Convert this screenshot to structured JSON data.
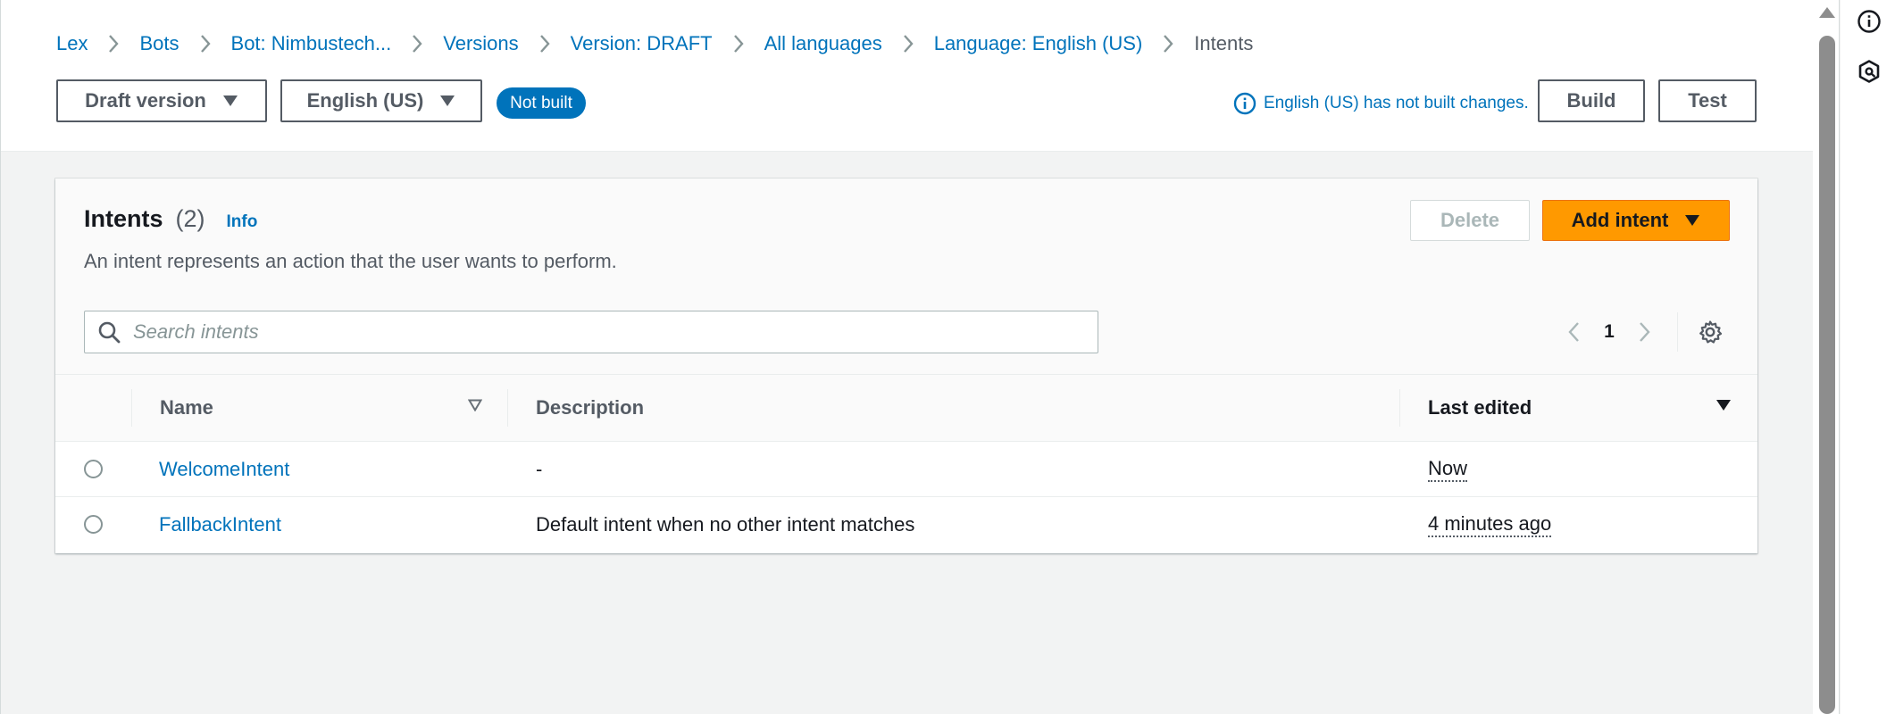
{
  "breadcrumb": [
    {
      "label": "Lex"
    },
    {
      "label": "Bots"
    },
    {
      "label": "Bot: Nimbustech..."
    },
    {
      "label": "Versions"
    },
    {
      "label": "Version: DRAFT"
    },
    {
      "label": "All languages"
    },
    {
      "label": "Language: English (US)"
    },
    {
      "label": "Intents"
    }
  ],
  "toolbar": {
    "version_label": "Draft version",
    "language_label": "English (US)",
    "status_badge": "Not built",
    "status_message": "English (US) has not built changes.",
    "build_label": "Build",
    "test_label": "Test"
  },
  "panel": {
    "title": "Intents",
    "count": "(2)",
    "info_label": "Info",
    "description": "An intent represents an action that the user wants to perform.",
    "delete_label": "Delete",
    "add_label": "Add intent"
  },
  "search": {
    "placeholder": "Search intents",
    "value": ""
  },
  "pagination": {
    "current_page": "1"
  },
  "table": {
    "headers": {
      "name": "Name",
      "description": "Description",
      "last_edited": "Last edited"
    },
    "rows": [
      {
        "name": "WelcomeIntent",
        "description": "-",
        "last_edited": "Now"
      },
      {
        "name": "FallbackIntent",
        "description": "Default intent when no other intent matches",
        "last_edited": "4 minutes ago"
      }
    ]
  },
  "colors": {
    "link": "#0073bb",
    "primary_button": "#ff9900",
    "badge": "#0073bb",
    "text": "#16191f",
    "muted_text": "#545b64"
  },
  "icons": {
    "breadcrumb_separator": "chevron-right-icon",
    "dropdown": "caret-down-icon",
    "status": "info-circle-icon",
    "search": "search-icon",
    "pagination_prev": "chevron-left-icon",
    "pagination_next": "chevron-right-icon",
    "preferences": "gear-icon",
    "sort_name": "sort-triangle-outline-icon",
    "sort_last_edited": "sort-triangle-filled-icon",
    "side_info": "info-circle-icon",
    "side_tool": "hexagon-icon"
  }
}
